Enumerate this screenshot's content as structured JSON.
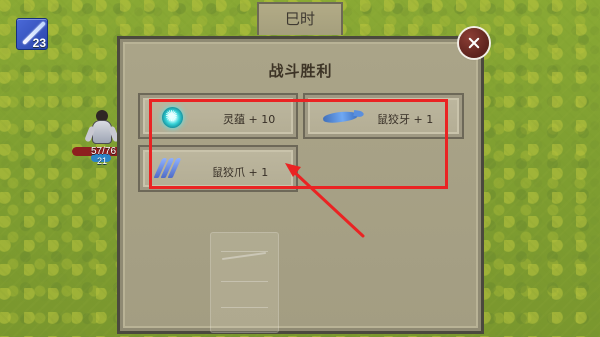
{
  "hud": {
    "skill_count": "23"
  },
  "time_tab": {
    "label": "巳时"
  },
  "dialog": {
    "title": "战斗胜利"
  },
  "rewards": [
    {
      "label": "灵蕴 + 10",
      "icon": "spirit-orb-icon"
    },
    {
      "label": "鼠狡牙 + 1",
      "icon": "rat-fang-icon"
    },
    {
      "label": "鼠狡爪 + 1",
      "icon": "rat-claw-icon"
    }
  ],
  "character": {
    "stats": "57/76",
    "level": "21"
  },
  "background_card": {
    "label": ""
  },
  "colors": {
    "highlight": "#ea2323",
    "close_button": "#6a2b25",
    "panel": "#a59f84",
    "grass": "#7f9f31"
  }
}
